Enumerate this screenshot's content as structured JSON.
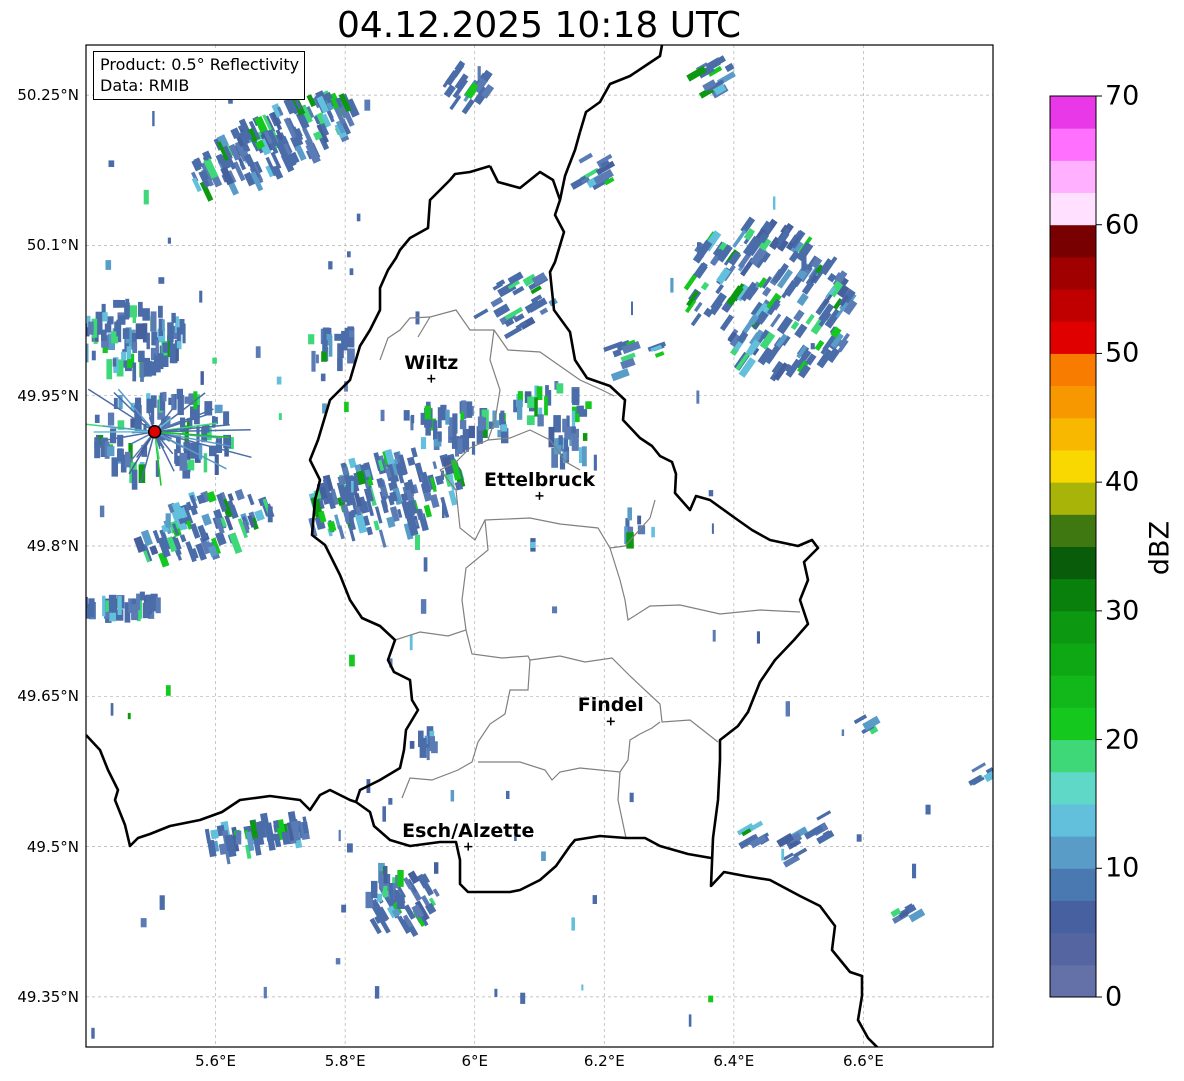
{
  "title": "04.12.2025 10:18 UTC",
  "info": {
    "product": "Product: 0.5° Reflectivity",
    "data": "Data: RMIB"
  },
  "axes": {
    "lon_ticks": [
      {
        "value": 5.6,
        "label": "5.6°E"
      },
      {
        "value": 5.8,
        "label": "5.8°E"
      },
      {
        "value": 6.0,
        "label": "6°E"
      },
      {
        "value": 6.2,
        "label": "6.2°E"
      },
      {
        "value": 6.4,
        "label": "6.4°E"
      },
      {
        "value": 6.6,
        "label": "6.6°E"
      }
    ],
    "lat_ticks": [
      {
        "value": 50.25,
        "label": "50.25°N"
      },
      {
        "value": 50.1,
        "label": "50.1°N"
      },
      {
        "value": 49.95,
        "label": "49.95°N"
      },
      {
        "value": 49.8,
        "label": "49.8°N"
      },
      {
        "value": 49.65,
        "label": "49.65°N"
      },
      {
        "value": 49.5,
        "label": "49.5°N"
      },
      {
        "value": 49.35,
        "label": "49.35°N"
      }
    ],
    "lon_range": [
      5.4,
      6.8
    ],
    "lat_range": [
      49.3,
      50.3
    ],
    "grid": true
  },
  "colorbar": {
    "label": "dBZ",
    "range": [
      0,
      70
    ],
    "step": 2.5,
    "ticks": [
      "0",
      "10",
      "20",
      "30",
      "40",
      "50",
      "60",
      "70"
    ],
    "colors": [
      "#6470a8",
      "#5565a2",
      "#4660a0",
      "#4a78b0",
      "#5a9cc8",
      "#62c0dc",
      "#60d8c8",
      "#3ed878",
      "#14c81e",
      "#12b81a",
      "#0ea814",
      "#0c9810",
      "#0a800c",
      "#085c0a",
      "#3f7810",
      "#a8b408",
      "#f8d800",
      "#f8b800",
      "#f89800",
      "#f87c00",
      "#e00000",
      "#c00000",
      "#a00000",
      "#780000",
      "#ffe0ff",
      "#ffb0ff",
      "#ff70ff",
      "#e838e8"
    ]
  },
  "cities": [
    {
      "name": "Wiltz",
      "lon": 5.933,
      "lat": 49.967
    },
    {
      "name": "Ettelbruck",
      "lon": 6.1,
      "lat": 49.85
    },
    {
      "name": "Findel",
      "lon": 6.21,
      "lat": 49.625
    },
    {
      "name": "Esch/Alzette",
      "lon": 5.99,
      "lat": 49.5
    }
  ],
  "radar_site": {
    "lon": 5.506,
    "lat": 49.914
  }
}
